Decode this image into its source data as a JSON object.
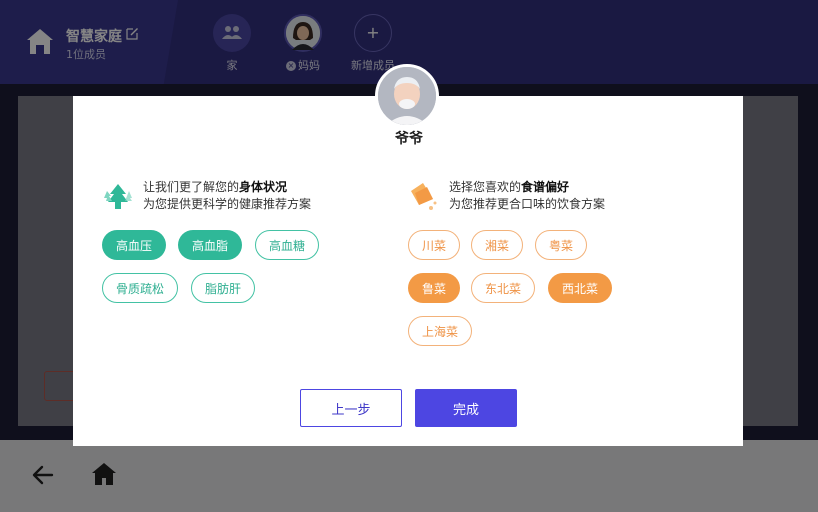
{
  "header": {
    "family_name": "智慧家庭",
    "member_count": "1位成员",
    "members": [
      {
        "label": "家",
        "icon": "people-icon"
      },
      {
        "label": "妈妈",
        "icon": "avatar-mother"
      },
      {
        "label": "新增成员",
        "icon": "plus-icon"
      }
    ]
  },
  "modal": {
    "member_name": "爷爷",
    "health": {
      "line1_prefix": "让我们更了解您的",
      "line1_bold": "身体状况",
      "line2": "为您提供更科学的健康推荐方案",
      "tags": [
        {
          "label": "高血压",
          "selected": true
        },
        {
          "label": "高血脂",
          "selected": true
        },
        {
          "label": "高血糖",
          "selected": false
        },
        {
          "label": "骨质疏松",
          "selected": false
        },
        {
          "label": "脂肪肝",
          "selected": false
        }
      ]
    },
    "cuisine": {
      "line1_prefix": "选择您喜欢的",
      "line1_bold": "食谱偏好",
      "line2": "为您推荐更合口味的饮食方案",
      "tags": [
        {
          "label": "川菜",
          "selected": false
        },
        {
          "label": "湘菜",
          "selected": false
        },
        {
          "label": "粤菜",
          "selected": false
        },
        {
          "label": "鲁菜",
          "selected": true
        },
        {
          "label": "东北菜",
          "selected": false
        },
        {
          "label": "西北菜",
          "selected": true
        },
        {
          "label": "上海菜",
          "selected": false
        }
      ]
    },
    "prev_label": "上一步",
    "done_label": "完成"
  },
  "colors": {
    "header_bg": "#33307f",
    "health_accent": "#2fb898",
    "cuisine_accent": "#f39a45",
    "primary_button": "#4d46e2"
  }
}
